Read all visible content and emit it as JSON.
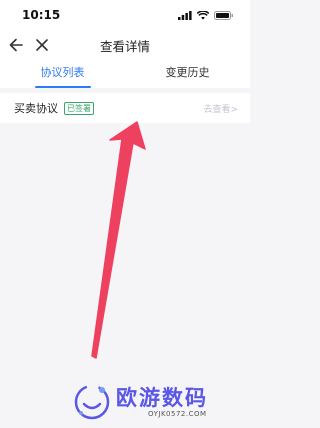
{
  "status_bar": {
    "time": "10:15"
  },
  "nav": {
    "title": "查看详情"
  },
  "tabs": [
    {
      "label": "协议列表",
      "active": true
    },
    {
      "label": "变更历史",
      "active": false
    }
  ],
  "agreement": {
    "name": "买卖协议",
    "status": "已签署",
    "action": "去查看>"
  },
  "watermark": {
    "title": "欧游数码",
    "subtitle": "OYJK0572.COM"
  },
  "colors": {
    "accent": "#2f7bf6",
    "status_green": "#3aa66a",
    "arrow_red": "#ee4160",
    "watermark_purple": "#5b57e6"
  }
}
